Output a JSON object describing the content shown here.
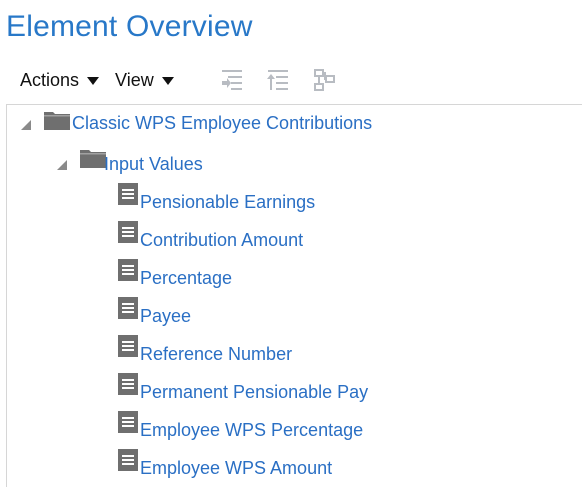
{
  "page": {
    "title": "Element Overview"
  },
  "toolbar": {
    "actions_label": "Actions",
    "view_label": "View"
  },
  "tree": {
    "root": {
      "label": "Classic WPS Employee Contributions",
      "expanded": true
    },
    "child": {
      "label": "Input Values",
      "expanded": true
    },
    "leaves": [
      {
        "label": "Pensionable Earnings"
      },
      {
        "label": "Contribution Amount"
      },
      {
        "label": "Percentage"
      },
      {
        "label": "Payee"
      },
      {
        "label": "Reference Number"
      },
      {
        "label": "Permanent Pensionable Pay"
      },
      {
        "label": "Employee WPS Percentage"
      },
      {
        "label": "Employee WPS Amount"
      }
    ]
  },
  "colors": {
    "title": "#2878c8",
    "link": "#2a6fc4",
    "icon": "#6f6f6f",
    "disabled_icon": "#b8bcc2"
  }
}
